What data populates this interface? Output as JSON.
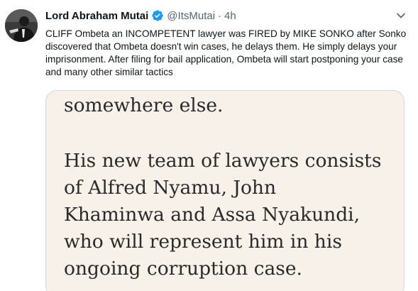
{
  "tweet": {
    "author_name": "Lord Abraham Mutai",
    "handle": "@ItsMutai",
    "separator": "·",
    "time": "4h",
    "text": "CLIFF Ombeta an INCOMPETENT lawyer was FIRED by MIKE SONKO after Sonko discovered that Ombeta doesn't win cases, he delays them. He simply delays your imprisonment. After filing for bail application, Ombeta will start postponing your case and many other similar tactics",
    "icons": {
      "verified": "verified-badge-icon",
      "more": "chevron-down-icon"
    },
    "colors": {
      "verified": "#1d9bf0",
      "secondary_text": "#536471",
      "media_background": "#f8f1e9"
    },
    "media": {
      "lines": [
        "somewhere else.",
        "His new team of lawyers consists",
        "of Alfred Nyamu, John",
        "Khaminwa and Assa Nyakundi,",
        "who will represent him in his",
        "ongoing corruption case."
      ]
    }
  }
}
